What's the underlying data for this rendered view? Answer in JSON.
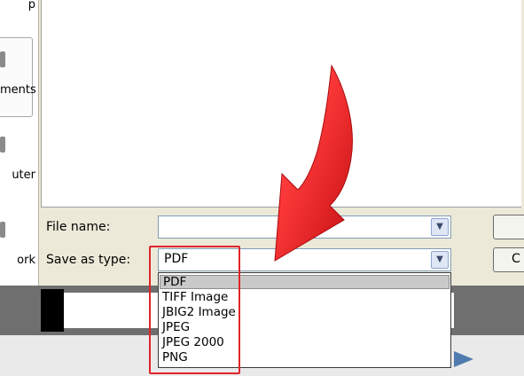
{
  "places": {
    "items": [
      {
        "label": "p"
      },
      {
        "label": "ments"
      },
      {
        "label": "uter"
      },
      {
        "label": "ork"
      }
    ]
  },
  "form": {
    "file_name_label": "File name:",
    "file_name_value": "",
    "save_type_label": "Save as type:",
    "save_type_value": "PDF"
  },
  "side_buttons": [
    "",
    "C"
  ],
  "dropdown": {
    "options": [
      "PDF",
      "TIFF Image",
      "JBIG2 Image",
      "JPEG",
      "JPEG 2000",
      "PNG"
    ],
    "selected": "PDF"
  },
  "colors": {
    "highlight": "#e0242a",
    "arrow": "#e8262a"
  },
  "icons": {
    "combo_arrow": "chevron-down-icon",
    "annotation": "curved-arrow-icon",
    "nav": "play-icon"
  }
}
